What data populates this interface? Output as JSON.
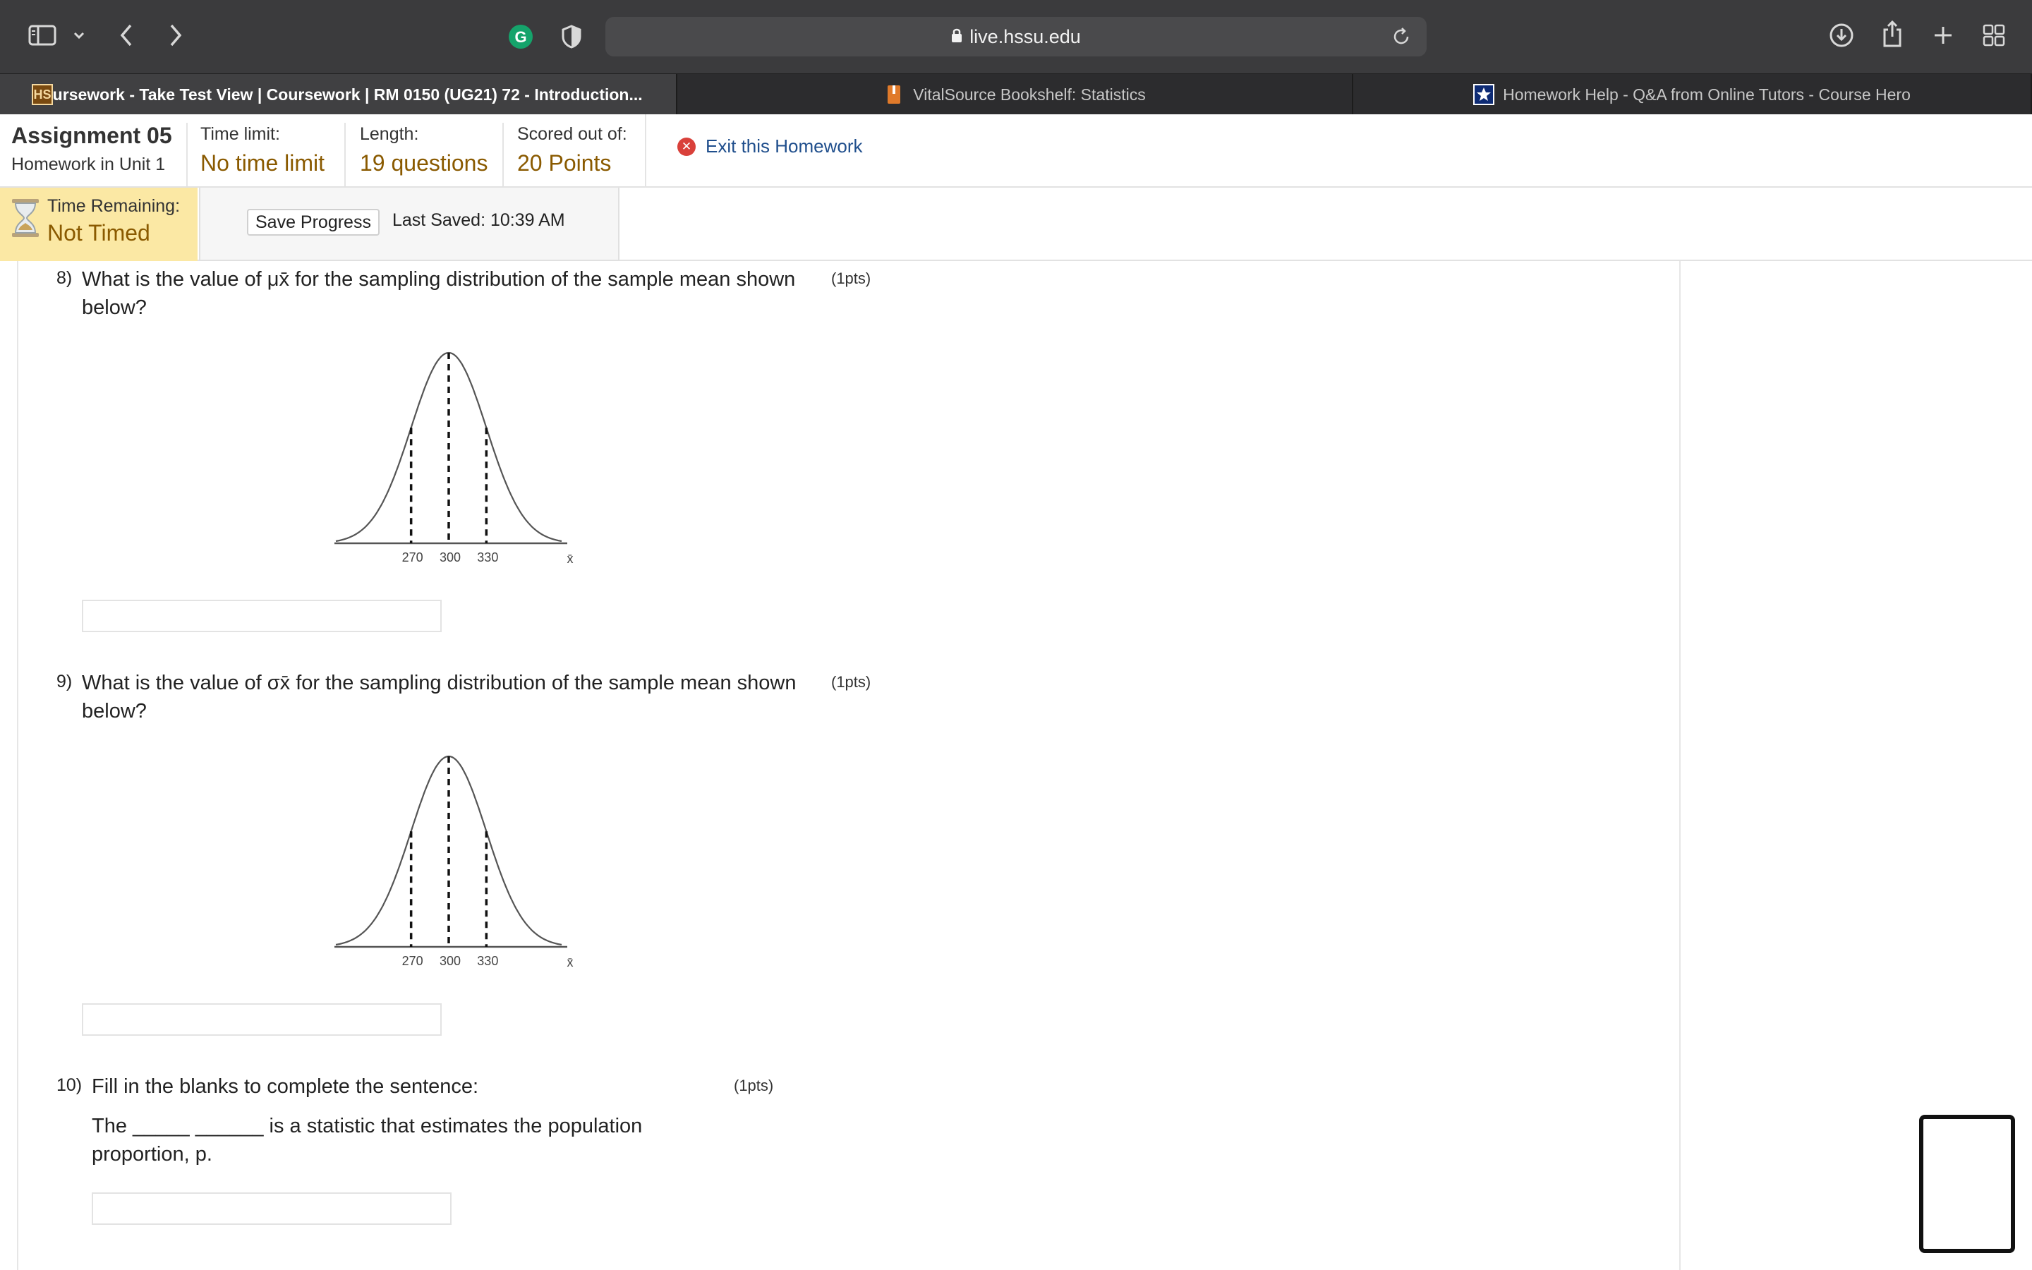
{
  "browser": {
    "url": "live.hssu.edu",
    "tabs": [
      {
        "favicon": "HS",
        "title": "Coursework - Take Test View | Coursework | RM 0150 (UG21) 72 - Introduction..."
      },
      {
        "favicon": "bookmark-icon",
        "title": "VitalSource Bookshelf: Statistics"
      },
      {
        "favicon": "star-icon",
        "title": "Homework Help - Q&A from Online Tutors - Course Hero"
      }
    ]
  },
  "assignment": {
    "title": "Assignment 05",
    "subtitle": "Homework in Unit 1",
    "time_limit_label": "Time limit:",
    "time_limit_value": "No time limit",
    "length_label": "Length:",
    "length_value": "19 questions",
    "scored_label": "Scored out of:",
    "scored_value": "20 Points",
    "exit_label": "Exit this Homework"
  },
  "timer": {
    "label": "Time Remaining:",
    "value": "Not Timed",
    "save_label": "Save Progress",
    "last_saved": "Last Saved: 10:39 AM"
  },
  "questions": [
    {
      "number": "8)",
      "text_line1": "What is the value of μx̄ for the sampling distribution of the sample mean shown",
      "text_line2": "below?",
      "points": "(1pts)"
    },
    {
      "number": "9)",
      "text_line1": "What is the value of σx̄ for the sampling distribution of the sample mean shown",
      "text_line2": "below?",
      "points": "(1pts)"
    },
    {
      "number": "10)",
      "text": "Fill in the blanks to complete the sentence:",
      "points": "(1pts)",
      "sentence_line1": "The _____ ______ is a statistic that estimates the population",
      "sentence_line2": "proportion, p."
    }
  ],
  "chart_data": [
    {
      "type": "line",
      "description": "normal curve with dashed lines at ticks",
      "tick_labels": [
        "270",
        "300",
        "330"
      ],
      "x_axis_symbol": "x̄",
      "mean": 300,
      "sd": 30,
      "xlim": [
        210,
        390
      ]
    },
    {
      "type": "line",
      "description": "normal curve with dashed lines at ticks",
      "tick_labels": [
        "270",
        "300",
        "330"
      ],
      "x_axis_symbol": "x̄",
      "mean": 300,
      "sd": 30,
      "xlim": [
        210,
        390
      ]
    }
  ]
}
